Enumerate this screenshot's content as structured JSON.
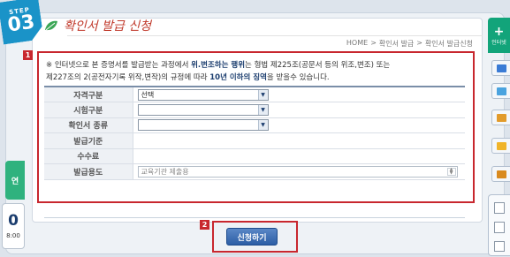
{
  "step": {
    "label": "STEP",
    "number": "03"
  },
  "page": {
    "title": "확인서 발급 신청"
  },
  "breadcrumb": [
    "HOME",
    ">",
    "확인서 발급",
    ">",
    "확인서 발급신청"
  ],
  "markers": {
    "one": "1",
    "two": "2"
  },
  "notice": {
    "p1": "※ 인터넷으로 본 증명서를 발급받는 과정에서 ",
    "h1": "위.변조하는 행위",
    "p2": "는 형법 제225조(공문서 등의 위조,변조) 또는",
    "p3": "제227조의 2(공전자기록 위작,변작)의 규정에 따라 ",
    "h2": "10년 이하의 징역",
    "p4": "을 받을수 있습니다."
  },
  "form": {
    "rows": [
      {
        "label": "자격구분",
        "type": "select",
        "value": "선택"
      },
      {
        "label": "시험구분",
        "type": "select",
        "value": ""
      },
      {
        "label": "확인서 종류",
        "type": "select",
        "value": ""
      },
      {
        "label": "발급기준",
        "type": "text",
        "value": ""
      },
      {
        "label": "수수료",
        "type": "text",
        "value": ""
      },
      {
        "label": "발급용도",
        "type": "input",
        "value": "교육기관 제출용"
      }
    ]
  },
  "actions": {
    "apply_label": "신청하기"
  },
  "left_rail": {
    "tab_label": "연",
    "big": "0",
    "small": "8:00"
  },
  "right_rail": {
    "top_label": "인터넷"
  },
  "colors": {
    "accent": "#1a93c8",
    "highlight": "#c8272e",
    "title": "#c0392b",
    "button": "#2c5ea5",
    "right_rail": "#12a47a",
    "left_tab": "#2fb27e"
  }
}
